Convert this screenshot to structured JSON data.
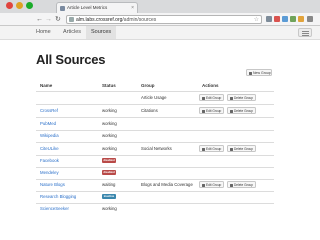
{
  "browser": {
    "tab_title": "Article Level Metrics",
    "tab_close": "×",
    "address_host": "alm.labs.crossref.org",
    "address_path": "/admin/sources",
    "back_glyph": "←",
    "forward_glyph": "→",
    "reload_glyph": "↻",
    "star_glyph": "☆"
  },
  "nav": {
    "items": [
      {
        "label": "Home"
      },
      {
        "label": "Articles"
      },
      {
        "label": "Sources"
      }
    ]
  },
  "page": {
    "title": "All Sources",
    "new_group_label": "New Group",
    "edit_label": "Edit Group",
    "delete_label": "Delete Group"
  },
  "table": {
    "columns": [
      "Name",
      "Status",
      "Group",
      "Actions"
    ],
    "groups": [
      {
        "name": "Article Usage"
      },
      {
        "name": "Citations"
      },
      {
        "name": "Social Networks"
      },
      {
        "name": "Blogs and Media Coverage"
      }
    ],
    "sources": [
      {
        "name": "CrossRef",
        "status": "working"
      },
      {
        "name": "PubMed",
        "status": "working"
      },
      {
        "name": "Wikipedia",
        "status": "working"
      },
      {
        "name": "CiteULike",
        "status": "working"
      },
      {
        "name": "Facebook",
        "badge": "disabled"
      },
      {
        "name": "Mendeley",
        "badge": "disabled"
      },
      {
        "name": "Nature Blogs",
        "status": "waiting"
      },
      {
        "name": "Research Blogging",
        "badge": "inactive"
      },
      {
        "name": "ScienceSeeker",
        "status": "working"
      }
    ]
  },
  "colors": {
    "link": "#2a6fc9",
    "badge_red": "#b94a48",
    "badge_blue": "#3a87ad"
  }
}
